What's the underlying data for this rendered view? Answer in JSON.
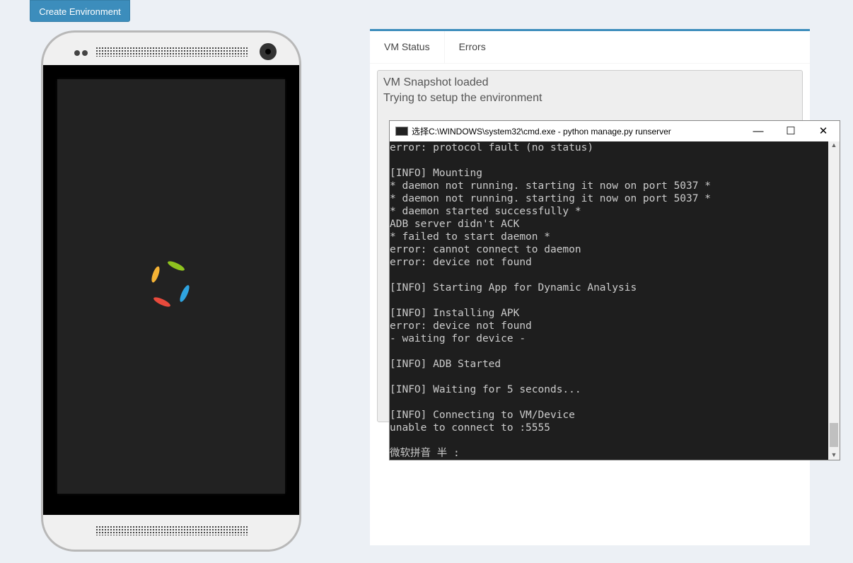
{
  "toolbar": {
    "create_label": "Create Environment"
  },
  "tabs": [
    {
      "label": "VM Status"
    },
    {
      "label": "Errors"
    }
  ],
  "status_lines": [
    "VM Snapshot loaded",
    "Trying to setup the environment"
  ],
  "cmd": {
    "title": "选择C:\\WINDOWS\\system32\\cmd.exe - python  manage.py runserver",
    "minimize": "—",
    "maximize": "☐",
    "close": "✕",
    "output": "error: protocol fault (no status)\n\n[INFO] Mounting\n* daemon not running. starting it now on port 5037 *\n* daemon not running. starting it now on port 5037 *\n* daemon started successfully *\nADB server didn't ACK\n* failed to start daemon *\nerror: cannot connect to daemon\nerror: device not found\n\n[INFO] Starting App for Dynamic Analysis\n\n[INFO] Installing APK\nerror: device not found\n- waiting for device -\n\n[INFO] ADB Started\n\n[INFO] Waiting for 5 seconds...\n\n[INFO] Connecting to VM/Device\nunable to connect to :5555\n\n微软拼音 半 :"
  },
  "colors": {
    "accent": "#3c8dbc",
    "terminal_bg": "#1e1e1e"
  }
}
